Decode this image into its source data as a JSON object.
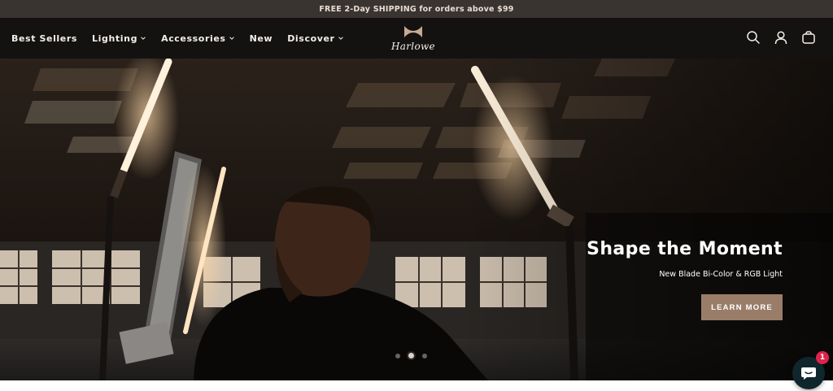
{
  "announcement": {
    "text": "FREE 2-Day SHIPPING for orders above $99"
  },
  "nav": {
    "items": [
      {
        "label": "Best Sellers",
        "dropdown": false
      },
      {
        "label": "Lighting",
        "dropdown": true
      },
      {
        "label": "Accessories",
        "dropdown": true
      },
      {
        "label": "New",
        "dropdown": false
      },
      {
        "label": "Discover",
        "dropdown": true
      }
    ]
  },
  "brand": {
    "name": "Harlowe"
  },
  "header_icons": [
    "search-icon",
    "account-icon",
    "cart-icon"
  ],
  "hero": {
    "title": "Shape the Moment",
    "subtitle": "New Blade Bi-Color & RGB Light",
    "cta_label": "LEARN MORE",
    "slides": 3,
    "active_slide": 2
  },
  "chat": {
    "badge_count": "1"
  },
  "colors": {
    "announcement_bg": "#3a3431",
    "header_bg": "#141211",
    "cta_bg": "#9a7d68",
    "chat_bg": "#10262d",
    "badge": "#e0234c"
  }
}
